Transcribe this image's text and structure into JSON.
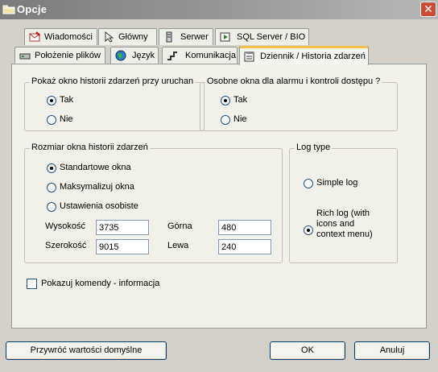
{
  "window": {
    "title": "Opcje",
    "close_label": "✕"
  },
  "tabs_row1": [
    {
      "label": "Wiadomości",
      "icon": "letter-icon"
    },
    {
      "label": "Główny",
      "icon": "pointer-icon"
    },
    {
      "label": "Serwer",
      "icon": "server-icon"
    },
    {
      "label": "SQL Server / BIO",
      "icon": "sql-server-icon"
    }
  ],
  "tabs_row2": [
    {
      "label": "Położenie plików",
      "icon": "drive-icon"
    },
    {
      "label": "Język",
      "icon": "globe-icon"
    },
    {
      "label": "Komunikacja",
      "icon": "plug-icon"
    },
    {
      "label": "Dziennik / Historia zdarzeń",
      "icon": "log-icon",
      "active": true
    }
  ],
  "group_show_history": {
    "legend": "Pokaż okno historii zdarzeń przy uruchan",
    "options": [
      "Tak",
      "Nie"
    ],
    "selected": "Tak"
  },
  "group_separate_windows": {
    "legend": "Osobne okna dla alarmu i kontroli dostępu ?",
    "options": [
      "Tak",
      "Nie"
    ],
    "selected": "Tak"
  },
  "group_window_size": {
    "legend": "Rozmiar okna historii zdarzeń",
    "options": [
      "Standartowe okna",
      "Maksymalizuj okna",
      "Ustawienia osobiste"
    ],
    "selected": "Standartowe okna",
    "fields": {
      "height_label": "Wysokość",
      "height_value": "3735",
      "width_label": "Szerokość",
      "width_value": "9015",
      "top_label": "Górna",
      "top_value": "480",
      "left_label": "Lewa",
      "left_value": "240"
    }
  },
  "group_log_type": {
    "legend": "Log type",
    "options": [
      "Simple log",
      "Rich log (with icons and context menu)"
    ],
    "selected": "Rich log (with icons and context menu)"
  },
  "show_commands": {
    "label": "Pokazuj komendy - informacja",
    "checked": false
  },
  "buttons": {
    "restore_defaults": "Przywróć wartości domyślne",
    "ok": "OK",
    "cancel": "Anuluj"
  }
}
